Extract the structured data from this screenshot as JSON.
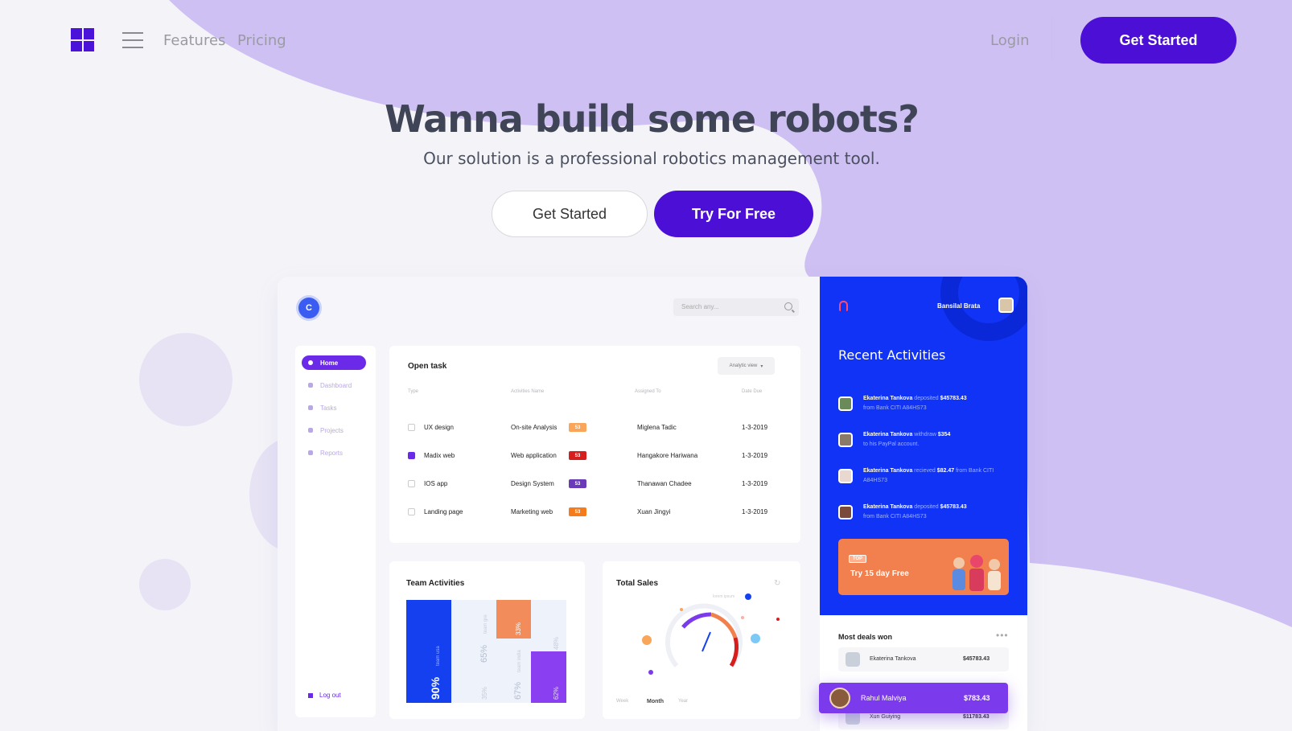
{
  "nav": {
    "features": "Features",
    "pricing": "Pricing",
    "login": "Login",
    "cta": "Get Started"
  },
  "hero": {
    "title": "Wanna build some robots?",
    "subtitle": "Our solution is a professional robotics management tool.",
    "btn_primary": "Get Started",
    "btn_secondary": "Try For Free"
  },
  "colors": {
    "brand": "#4b0fd6",
    "blob": "#cfc0f3",
    "panel_blue": "#1033f5",
    "accent_orange": "#f27f4e"
  },
  "dashboard": {
    "logo_letter": "C",
    "search_placeholder": "Search any...",
    "sidebar": {
      "items": [
        {
          "label": "Home",
          "icon": "home-icon"
        },
        {
          "label": "Dashboard",
          "icon": "dashboard-icon"
        },
        {
          "label": "Tasks",
          "icon": "tasks-icon"
        },
        {
          "label": "Projects",
          "icon": "projects-icon"
        },
        {
          "label": "Reports",
          "icon": "reports-icon"
        }
      ],
      "logout": "Log out"
    },
    "open_task": {
      "title": "Open task",
      "view_select": "Analytic view",
      "headers": [
        "Type",
        "Activities Name",
        "Assigned To",
        "Date Due"
      ],
      "rows": [
        {
          "type": "UX design",
          "activity": "On-site Analysis",
          "tag": "53",
          "tag_color": "#f9a65a",
          "assignee": "Miglena Tadic",
          "due": "1-3-2019",
          "checked": false
        },
        {
          "type": "Madix web",
          "activity": "Web application",
          "tag": "53",
          "tag_color": "#d71e1e",
          "assignee": "Hangakore Hariwana",
          "due": "1-3-2019",
          "checked": true
        },
        {
          "type": "IOS app",
          "activity": "Design System",
          "tag": "53",
          "tag_color": "#6a3ab8",
          "assignee": "Thanawan Chadee",
          "due": "1-3-2019",
          "checked": false
        },
        {
          "type": "Landing page",
          "activity": "Marketing web",
          "tag": "53",
          "tag_color": "#f57c1c",
          "assignee": "Xuan Jingyi",
          "due": "1-3-2019",
          "checked": false
        }
      ]
    },
    "team_activities": {
      "title": "Team Activities",
      "bars": [
        {
          "value": "90%",
          "label": "team usa",
          "color": "#1440f0"
        },
        {
          "value": "65%",
          "label": "team gre",
          "color": "#eef3fb"
        },
        {
          "value": "35%",
          "label": "",
          "color": "#eef3fb"
        },
        {
          "value": "33%",
          "label": "",
          "color": "#f28c5a"
        },
        {
          "value": "67%",
          "label": "team india",
          "color": "#eef3fb"
        },
        {
          "value": "48%",
          "label": "",
          "color": "#eef3fb"
        },
        {
          "value": "62%",
          "label": "",
          "color": "#8a3ff0"
        }
      ]
    },
    "total_sales": {
      "title": "Total Sales",
      "tabs": [
        "Week",
        "Month",
        "Year"
      ],
      "active_tab": "Month",
      "gauge_label": "lorem ipsum"
    },
    "right_panel": {
      "user": "Bansilal Brata",
      "title": "Recent Activities",
      "activities": [
        {
          "name": "Ekaterina Tankova",
          "action": "deposited",
          "amount": "$45783.43",
          "detail": "from Bank CITI A84HS73"
        },
        {
          "name": "Ekaterina Tankova",
          "action": "withdraw",
          "amount": "$354",
          "detail": "to his PayPal account."
        },
        {
          "name": "Ekaterina Tankova",
          "action": "recieved",
          "amount": "$82.47",
          "detail": "from Bank CITI A84HS73"
        },
        {
          "name": "Ekaterina Tankova",
          "action": "deposited",
          "amount": "$45783.43",
          "detail": "from Bank CITI A84HS73"
        }
      ],
      "promo_tag": "TOP",
      "promo_text": "Try 15 day Free"
    },
    "deals": {
      "title": "Most deals won",
      "more": "•••",
      "rows": [
        {
          "name": "Ekaterina Tankova",
          "value": "$45783.43"
        },
        {
          "name": "Rahul Malviya",
          "value": "$783.43"
        },
        {
          "name": "Xun Guiying",
          "value": "$11783.43"
        }
      ]
    }
  }
}
